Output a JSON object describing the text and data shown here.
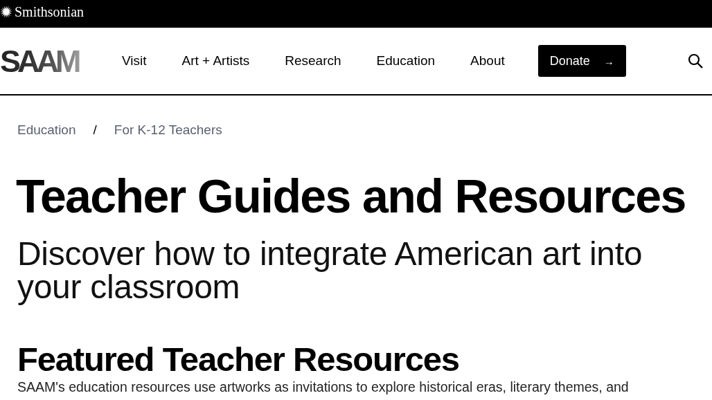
{
  "top_bar": {
    "brand": "Smithsonian"
  },
  "header": {
    "logo": "SAAM",
    "nav": [
      {
        "label": "Visit"
      },
      {
        "label": "Art + Artists"
      },
      {
        "label": "Research"
      },
      {
        "label": "Education"
      },
      {
        "label": "About"
      }
    ],
    "donate": {
      "label": "Donate",
      "icon": "→"
    }
  },
  "breadcrumb": [
    {
      "label": "Education"
    },
    {
      "label": "For K-12 Teachers"
    }
  ],
  "breadcrumb_separator": "/",
  "title": "Teacher Guides and Resources",
  "subtitle": "Discover how to integrate American art into your classroom",
  "section": {
    "heading": "Featured Teacher Resources",
    "text": "SAAM's education resources use artworks as invitations to explore historical eras, literary themes, and"
  }
}
